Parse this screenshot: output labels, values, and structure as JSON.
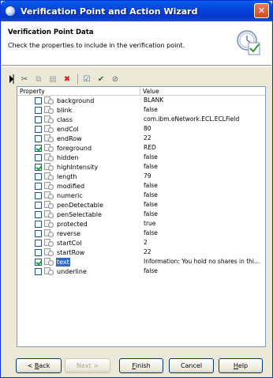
{
  "window": {
    "title": "Verification Point and Action Wizard",
    "close_glyph": "✕"
  },
  "header": {
    "title": "Verification Point Data",
    "description": "Check the properties to include in the verification point.",
    "graphic_icon": "checklist-clock-icon"
  },
  "toolbar": {
    "buttons": [
      {
        "icon": "cut-icon",
        "glyph": "✂"
      },
      {
        "icon": "copy-icon",
        "glyph": "⧉"
      },
      {
        "icon": "paste-icon",
        "glyph": "▤"
      },
      {
        "icon": "delete-icon",
        "glyph": "✖"
      },
      {
        "icon": "check-icon",
        "glyph": "☑"
      },
      {
        "icon": "check-all-icon",
        "glyph": "✔"
      },
      {
        "icon": "uncheck-icon",
        "glyph": "⊘"
      }
    ]
  },
  "table": {
    "headers": {
      "property": "Property",
      "value": "Value"
    },
    "rows": [
      {
        "property": "background",
        "value": "BLANK",
        "checked": false
      },
      {
        "property": "blink",
        "value": "false",
        "checked": false
      },
      {
        "property": "class",
        "value": "com.ibm.eNetwork.ECL.ECLField",
        "checked": false
      },
      {
        "property": "endCol",
        "value": "80",
        "checked": false
      },
      {
        "property": "endRow",
        "value": "22",
        "checked": false
      },
      {
        "property": "foreground",
        "value": "RED",
        "checked": true
      },
      {
        "property": "hidden",
        "value": "false",
        "checked": false
      },
      {
        "property": "highIntensity",
        "value": "false",
        "checked": true
      },
      {
        "property": "length",
        "value": "79",
        "checked": false
      },
      {
        "property": "modified",
        "value": "false",
        "checked": false
      },
      {
        "property": "numeric",
        "value": "false",
        "checked": false
      },
      {
        "property": "penDetectable",
        "value": "false",
        "checked": false
      },
      {
        "property": "penSelectable",
        "value": "false",
        "checked": false
      },
      {
        "property": "protected",
        "value": "true",
        "checked": false
      },
      {
        "property": "reverse",
        "value": "false",
        "checked": false
      },
      {
        "property": "startCol",
        "value": "2",
        "checked": false
      },
      {
        "property": "startRow",
        "value": "22",
        "checked": false
      },
      {
        "property": "text",
        "value": "Information: You hold no shares in thi...",
        "checked": true,
        "selected": true
      },
      {
        "property": "underline",
        "value": "false",
        "checked": false
      }
    ]
  },
  "buttons": {
    "back": {
      "pre": "< ",
      "mnemonic": "B",
      "post": "ack"
    },
    "next": "Next >",
    "finish": {
      "mnemonic": "F",
      "post": "inish"
    },
    "cancel": "Cancel",
    "help": {
      "mnemonic": "H",
      "post": "elp"
    }
  },
  "colors": {
    "titlebar": "#0842d6",
    "selection": "#316ac5",
    "check": "#21a121"
  }
}
